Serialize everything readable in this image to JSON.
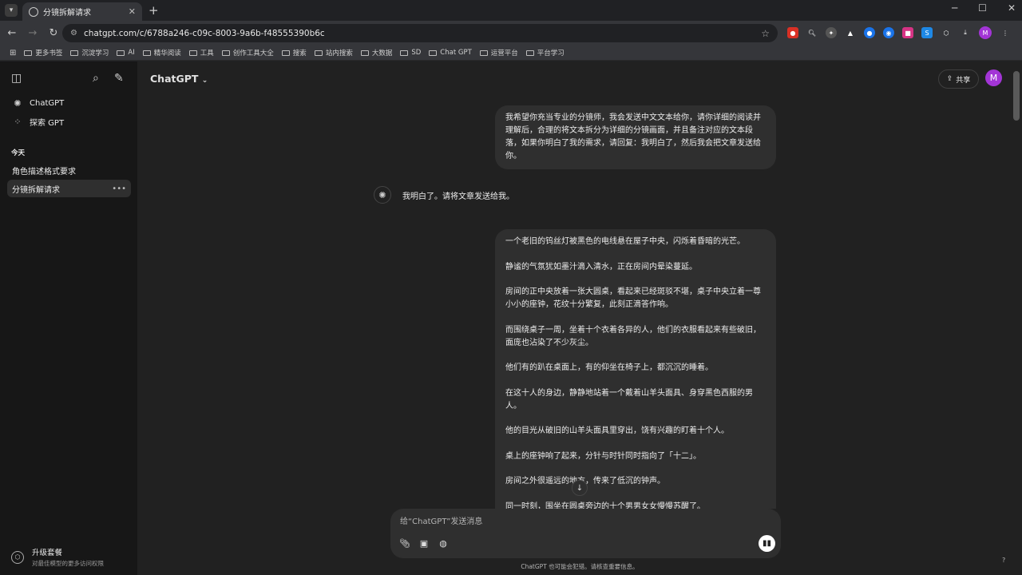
{
  "browser": {
    "tab_title": "分镜拆解请求",
    "url": "chatgpt.com/c/6788a246-c09c-8003-9a6b-f48555390b6c",
    "bookmarks": [
      "更多书签",
      "沉淀学习",
      "AI",
      "精华阅读",
      "工具",
      "创作工具大全",
      "搜索",
      "站内搜索",
      "大数据",
      "SD",
      "Chat GPT",
      "运营平台",
      "平台学习"
    ]
  },
  "sidebar": {
    "chatgpt_label": "ChatGPT",
    "explore_label": "探索 GPT",
    "section_today": "今天",
    "history": [
      "角色描述格式要求",
      "分镜拆解请求"
    ],
    "upgrade_title": "升级套餐",
    "upgrade_sub": "对最佳模型的更多访问权限"
  },
  "header": {
    "model": "ChatGPT",
    "share_label": "共享",
    "avatar_letter": "M"
  },
  "messages": {
    "user1": "我希望你充当专业的分镜师，我会发送中文文本给你，请你详细的阅读并理解后，合理的将文本拆分为详细的分镜画面，并且备注对应的文本段落，如果你明白了我的需求，请回复：我明白了，然后我会把文章发送给你。",
    "assistant1": "我明白了。请将文章发送给我。",
    "user2": [
      "一个老旧的钨丝灯被黑色的电线悬在屋子中央，闪烁着昏暗的光芒。",
      "静谧的气氛犹如墨汁滴入清水，正在房间内晕染蔓延。",
      "房间的正中央放着一张大圆桌，看起来已经斑驳不堪，桌子中央立着一尊小小的座钟，花纹十分繁复，此刻正滴答作响。",
      "而围绕桌子一周，坐着十个衣着各异的人，他们的衣服看起来有些破旧，面庞也沾染了不少灰尘。",
      "他们有的趴在桌面上，有的仰坐在椅子上，都沉沉的睡着。",
      "在这十人的身边，静静地站着一个戴着山羊头面具、身穿黑色西服的男人。",
      "他的目光从破旧的山羊头面具里穿出，饶有兴趣的盯着十个人。",
      "桌上的座钟响了起来，分针与时针同时指向了「十二」。",
      "房间之外很遥远的地方，传来了低沉的钟声。",
      "同一时刻，围坐在圆桌旁边的十个男男女女慢慢苏醒了。"
    ]
  },
  "composer": {
    "placeholder": "给“ChatGPT”发送消息",
    "footer": "ChatGPT 也可能会犯错。请核查重要信息。"
  }
}
